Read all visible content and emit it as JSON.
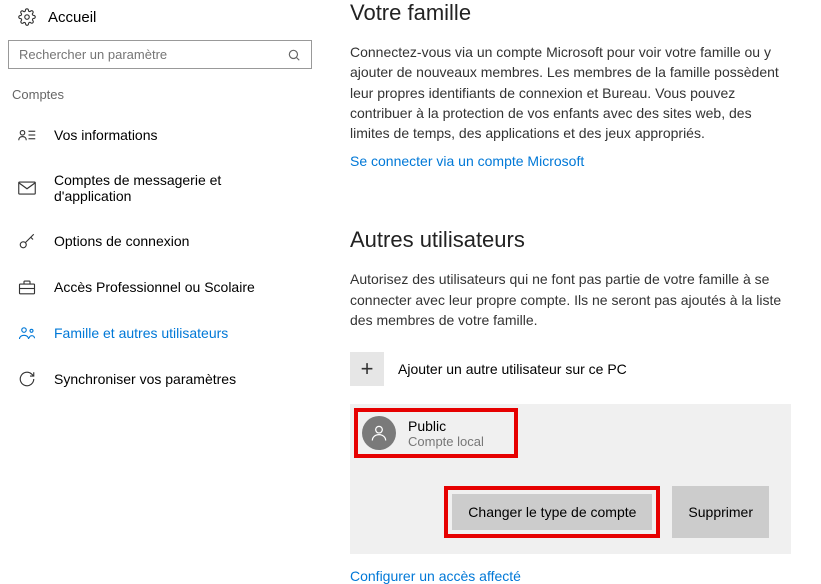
{
  "sidebar": {
    "home": "Accueil",
    "search_placeholder": "Rechercher un paramètre",
    "category": "Comptes",
    "items": [
      {
        "label": "Vos informations"
      },
      {
        "label": "Comptes de messagerie et d'application"
      },
      {
        "label": "Options de connexion"
      },
      {
        "label": "Accès Professionnel ou Scolaire"
      },
      {
        "label": "Famille et autres utilisateurs"
      },
      {
        "label": "Synchroniser vos paramètres"
      }
    ]
  },
  "family": {
    "title": "Votre famille",
    "desc": "Connectez-vous via un compte Microsoft pour voir votre famille ou y ajouter de nouveaux membres. Les membres de la famille possèdent leur propres identifiants de connexion et Bureau. Vous pouvez contribuer à la protection de vos enfants avec des sites web, des limites de temps, des applications et des jeux appropriés.",
    "signin_link": "Se connecter via un compte Microsoft"
  },
  "others": {
    "title": "Autres utilisateurs",
    "desc": "Autorisez des utilisateurs qui ne font pas partie de votre famille à se connecter avec leur propre compte. Ils ne seront pas ajoutés à la liste des membres de votre famille.",
    "add_label": "Ajouter un autre utilisateur sur ce PC",
    "user": {
      "name": "Public",
      "type": "Compte local"
    },
    "change_type_btn": "Changer le type de compte",
    "delete_btn": "Supprimer",
    "config_link": "Configurer un accès affecté"
  }
}
